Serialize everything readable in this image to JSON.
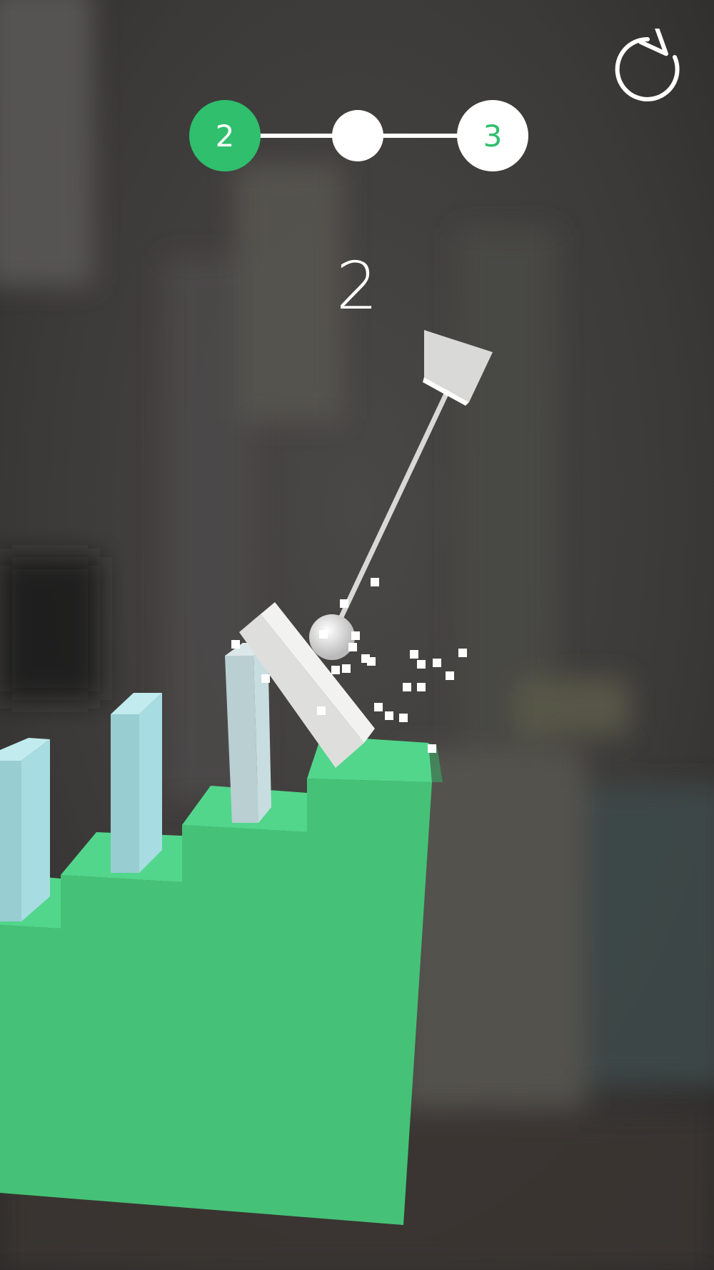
{
  "game": {
    "score": "2",
    "level_progress": {
      "current_level": "2",
      "next_level": "3",
      "stage_index": 1,
      "stage_total": 2
    },
    "colors": {
      "accent_green": "#2fbf6d",
      "platform_green": "#45c277",
      "platform_top_green": "#52d68c",
      "domino_blue": "#a7dde2",
      "white": "#ffffff"
    },
    "icons": {
      "restart": "restart-icon"
    }
  }
}
